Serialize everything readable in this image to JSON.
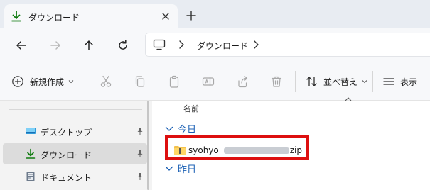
{
  "tab": {
    "label": "ダウンロード",
    "icon": "download-icon"
  },
  "toolbar": {
    "back_icon": "arrow-left-icon",
    "forward_icon": "arrow-right-icon",
    "up_icon": "arrow-up-icon",
    "refresh_icon": "refresh-icon"
  },
  "address": {
    "crumbs": [
      "ダウンロード"
    ]
  },
  "commandbar": {
    "new_label": "新規作成",
    "sort_label": "並べ替え",
    "view_label": "表示"
  },
  "nav": {
    "items": [
      {
        "label": "デスクトップ",
        "icon": "desktop-icon",
        "pinned": true,
        "selected": false
      },
      {
        "label": "ダウンロード",
        "icon": "download-icon",
        "pinned": true,
        "selected": true
      },
      {
        "label": "ドキュメント",
        "icon": "document-icon",
        "pinned": true,
        "selected": false
      }
    ]
  },
  "content": {
    "column_name": "名前",
    "groups": [
      {
        "label": "今日",
        "files": [
          {
            "name_prefix": "syohyo_",
            "name_suffix": "zip",
            "icon": "zip-folder-icon"
          }
        ]
      },
      {
        "label": "昨日",
        "files": []
      }
    ]
  },
  "colors": {
    "accent": "#0f7b0f",
    "group_text": "#1a5fb4",
    "highlight": "#dd0f0f"
  }
}
